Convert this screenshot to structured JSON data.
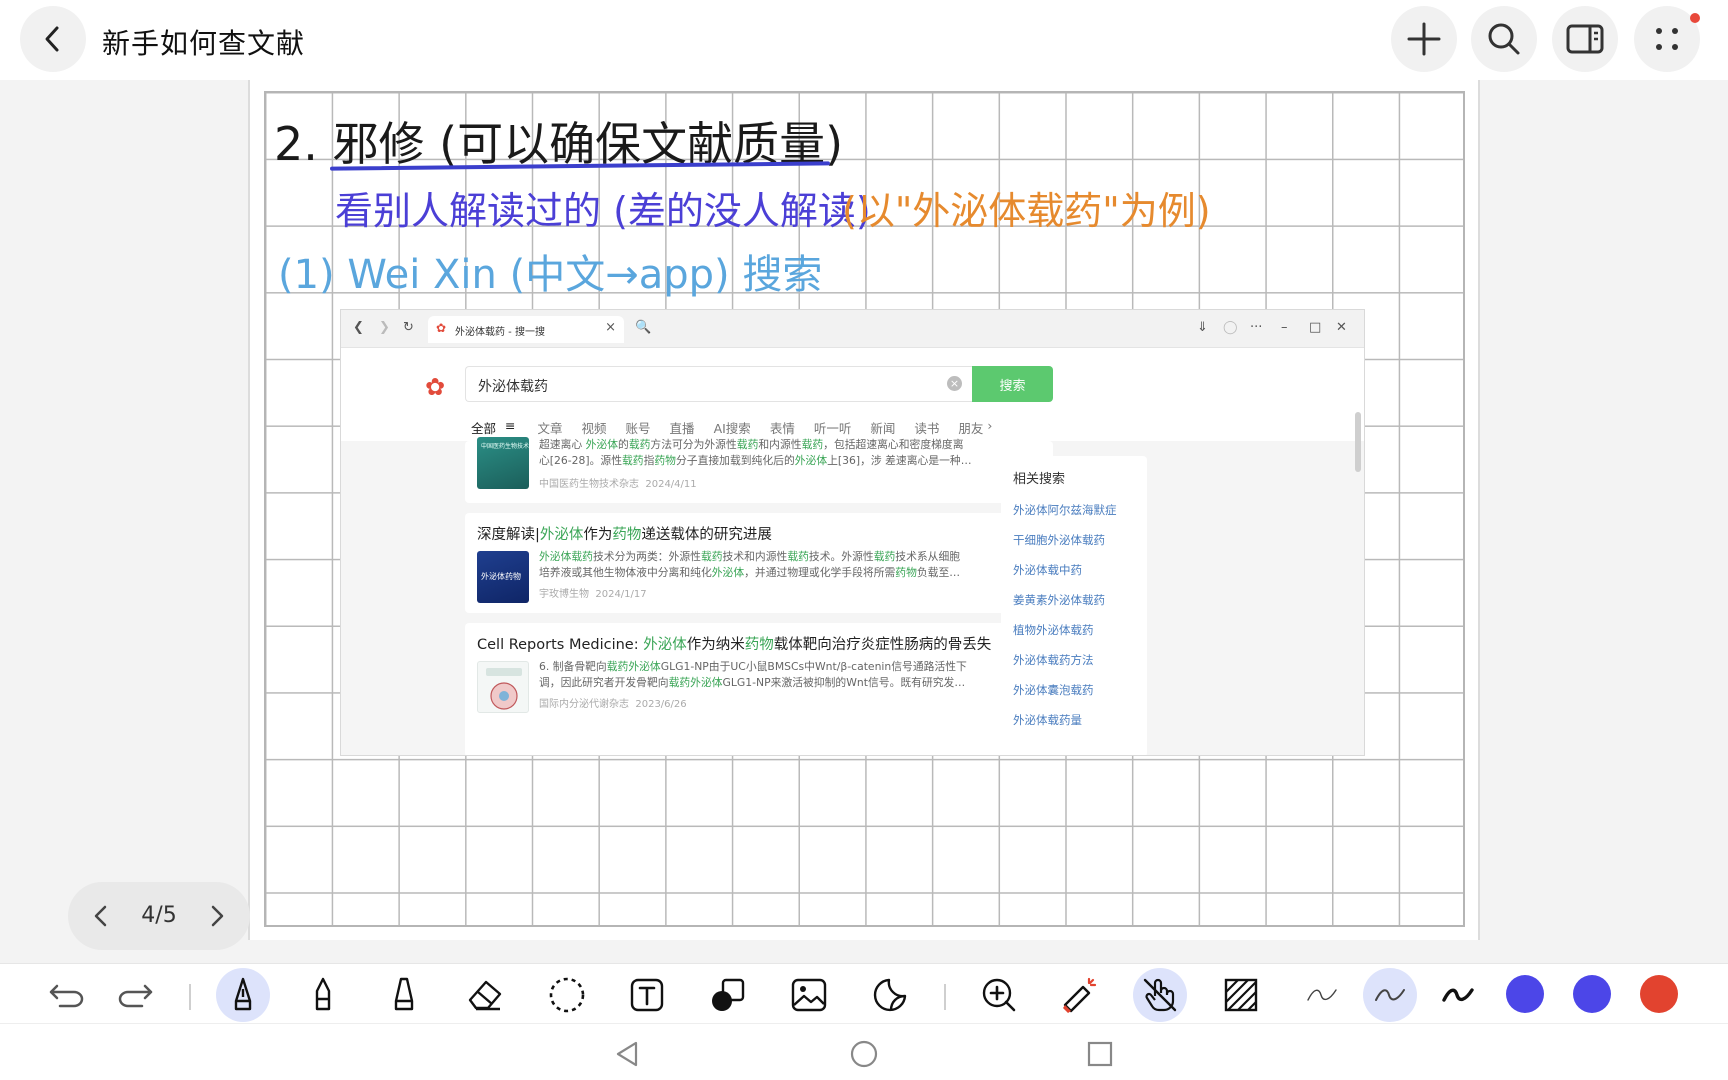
{
  "header": {
    "note_title": "新手如何查文献"
  },
  "handwriting": {
    "line1": "2. 邪修 (可以确保文献质量)",
    "line2": "看别人解读过的 (差的没人解读)",
    "line2_note": "(以\"外泌体载药\"为例)",
    "line3": "(1)  Wei   Xin (中文→app) 搜索"
  },
  "browser": {
    "tab_title": "外泌体载药 - 搜一搜",
    "search_query": "外泌体载药",
    "search_button": "搜索",
    "filter_tabs": [
      "全部",
      "文章",
      "视频",
      "账号",
      "直播",
      "AI搜索",
      "表情",
      "听一听",
      "新闻",
      "读书",
      "朋友"
    ],
    "results": [
      {
        "snippet_line1": "超速离心 外泌体的载药方法可分为外源性载药和内源性载药，包括超速离心和密度梯度离",
        "snippet_line2": "心[26-28]。源性载药指药物分子直接加载到纯化后的外泌体上[36]，涉 差速离心是一种…",
        "source": "中国医药生物技术杂志",
        "date": "2024/4/11",
        "thumb_caption": "中国医药生物技术"
      },
      {
        "title_a": "深度解读|",
        "title_hl1": "外泌体",
        "title_b": "作为",
        "title_hl2": "药物",
        "title_c": "递送载体的研究进展",
        "snippet_line1": "外泌体载药技术分为两类：外源性载药技术和内源性载药技术。外源性载药技术系从细胞",
        "snippet_line2": "培养液或其他生物体液中分离和纯化外泌体，并通过物理或化学手段将所需药物负载至…",
        "source": "宇玫博生物",
        "date": "2024/1/17",
        "thumb_caption": "外泌体药物"
      },
      {
        "title_a": "Cell Reports Medicine: ",
        "title_hl1": "外泌体",
        "title_b": "作为纳米",
        "title_hl2": "药物",
        "title_c": "载体靶向治疗炎症性肠病的骨丢失",
        "snippet_line1": "6. 制备骨靶向载药外泌体GLG1-NP由于UC小鼠BMSCs中Wnt/β-catenin信号通路活性下",
        "snippet_line2": "调，因此研究者开发骨靶向载药外泌体GLG1-NP来激活被抑制的Wnt信号。既有研究发…",
        "source": "国际内分泌代谢杂志",
        "date": "2023/6/26"
      }
    ],
    "related": {
      "title": "相关搜索",
      "items": [
        "外泌体阿尔兹海默症",
        "干细胞外泌体载药",
        "外泌体载中药",
        "姜黄素外泌体载药",
        "植物外泌体载药",
        "外泌体载药方法",
        "外泌体囊泡载药",
        "外泌体载药量"
      ]
    }
  },
  "pager": {
    "current": "4",
    "total": "5",
    "label": "4/5"
  },
  "colors": {
    "handwriting_blue": "#4b3fd6",
    "handwriting_orange": "#e68a2e",
    "handwriting_lightblue": "#5aa6dd",
    "search_green": "#5cc96f",
    "swatch_1": "#4c46e8",
    "swatch_2": "#4c46e8",
    "swatch_3": "#e2432f"
  }
}
